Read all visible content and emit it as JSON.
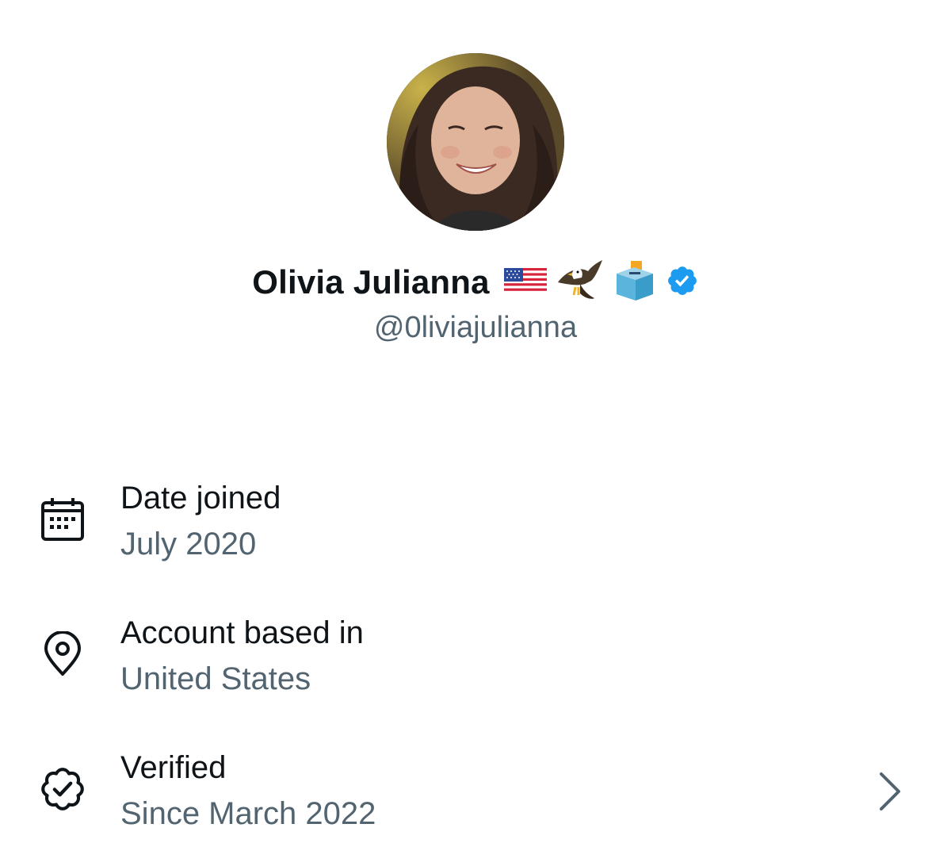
{
  "profile": {
    "display_name": "Olivia Julianna",
    "name_emojis": [
      "us-flag-emoji",
      "eagle-emoji",
      "ballot-box-emoji"
    ],
    "handle": "@0liviajulianna",
    "verified_badge_color": "#1d9bf0"
  },
  "about": {
    "items": [
      {
        "icon": "calendar-icon",
        "title": "Date joined",
        "value": "July 2020"
      },
      {
        "icon": "location-pin-icon",
        "title": "Account based in",
        "value": "United States"
      },
      {
        "icon": "verified-badge-icon",
        "title": "Verified",
        "value": "Since March 2022",
        "has_chevron": true
      }
    ]
  },
  "colors": {
    "primary_text": "#0f1419",
    "secondary_text": "#536471",
    "accent": "#1d9bf0"
  }
}
